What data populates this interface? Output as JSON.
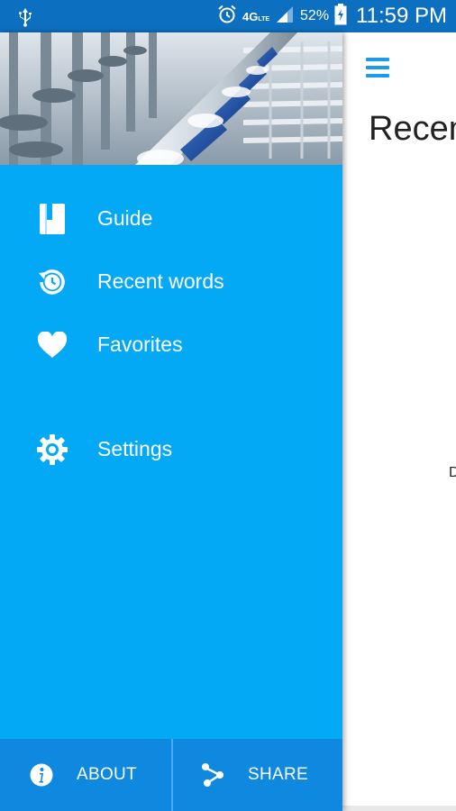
{
  "status_bar": {
    "time": "11:59 PM",
    "battery_percent": "52%",
    "network": "4G",
    "network_sub": "LTE",
    "icons": [
      "usb-icon",
      "alarm-icon",
      "signal-icon",
      "battery-charging-icon"
    ]
  },
  "main": {
    "title": "Recen",
    "stray_text": "D"
  },
  "drawer": {
    "header_image": "industrial-pipes-image",
    "items": [
      {
        "label": "Guide",
        "icon": "book-icon"
      },
      {
        "label": "Recent words",
        "icon": "history-icon"
      },
      {
        "label": "Favorites",
        "icon": "heart-icon"
      },
      {
        "label": "Settings",
        "icon": "gear-icon"
      }
    ],
    "footer": {
      "about_label": "ABOUT",
      "share_label": "SHARE"
    }
  },
  "colors": {
    "drawer_bg": "#03a9f4",
    "footer_bg": "#0f89e0",
    "status_bar_bg": "#0d6fbf",
    "accent": "#1e9be8"
  }
}
